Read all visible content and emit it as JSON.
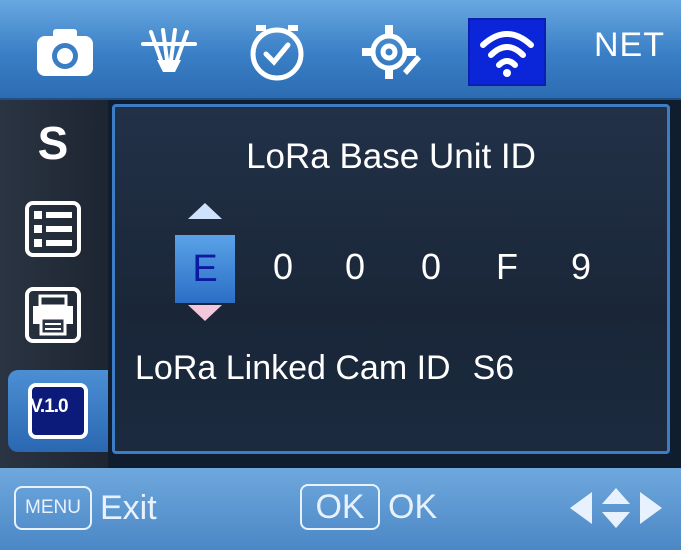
{
  "tabs": [
    {
      "id": "camera",
      "icon": "camera-icon",
      "active": false
    },
    {
      "id": "trigger",
      "icon": "trigger-sensor-icon",
      "active": false
    },
    {
      "id": "time",
      "icon": "clock-icon",
      "active": false
    },
    {
      "id": "settings",
      "icon": "gear-icon",
      "active": false
    },
    {
      "id": "network",
      "icon": "wifi-icon",
      "active": true
    },
    {
      "id": "net",
      "label": "NET",
      "active": false
    }
  ],
  "sidebar": {
    "items": [
      {
        "icon": "s-icon",
        "label": "S"
      },
      {
        "icon": "numbered-list-icon"
      },
      {
        "icon": "printer-icon"
      },
      {
        "icon": "version-icon",
        "label": "V.1.0",
        "selected": true
      }
    ]
  },
  "panel": {
    "title": "LoRa Base Unit ID",
    "id_digits": [
      "E",
      "0",
      "0",
      "0",
      "F",
      "9"
    ],
    "selected_index": 0,
    "linked_label": "LoRa Linked Cam ID",
    "linked_value": "S6"
  },
  "footer": {
    "menu_key": "MENU",
    "menu_action": "Exit",
    "ok_key": "OK",
    "ok_action": "OK",
    "nav_icon": "direction-arrows-icon"
  },
  "colors": {
    "accent": "#3a7fc6",
    "active_tab": "#0b26d8",
    "panel_bg": "#1a2638",
    "selected_digit": "#2b6fc6"
  }
}
